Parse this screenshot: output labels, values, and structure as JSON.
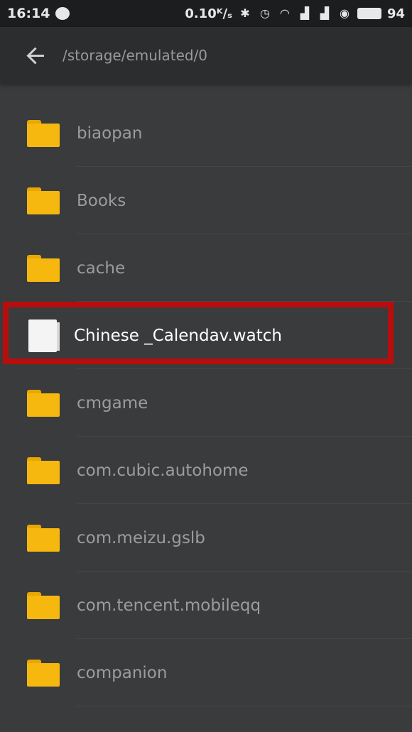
{
  "status_bar": {
    "time": "16:14",
    "network_speed": "0.10ᴷ/ₛ",
    "battery_level": "94",
    "icons": [
      "chat-icon",
      "bluetooth-icon",
      "alarm-icon",
      "wifi-icon",
      "signal-icon",
      "signal-icon",
      "data-saver-icon",
      "battery-icon"
    ]
  },
  "app_bar": {
    "path": "/storage/emulated/0"
  },
  "files": [
    {
      "name": "biaopan",
      "type": "folder"
    },
    {
      "name": "Books",
      "type": "folder"
    },
    {
      "name": "cache",
      "type": "folder"
    },
    {
      "name": "Chinese _Calendav.watch",
      "type": "file",
      "highlighted": true
    },
    {
      "name": "cmgame",
      "type": "folder"
    },
    {
      "name": "com.cubic.autohome",
      "type": "folder"
    },
    {
      "name": "com.meizu.gslb",
      "type": "folder"
    },
    {
      "name": "com.tencent.mobileqq",
      "type": "folder"
    },
    {
      "name": "companion",
      "type": "folder"
    }
  ],
  "colors": {
    "highlight_border": "#b80d0d",
    "folder": "#f6b80f",
    "background": "#3a3b3d"
  }
}
